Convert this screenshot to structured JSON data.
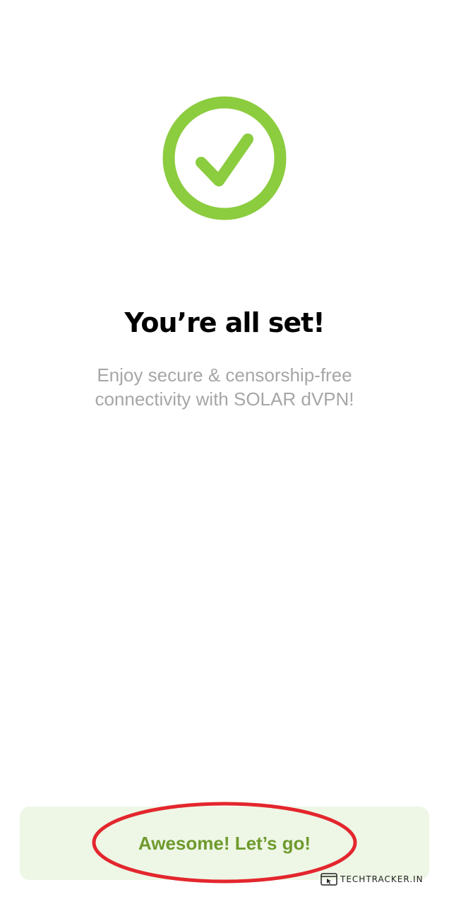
{
  "success": {
    "icon": "check-circle-icon",
    "title": "You’re all set!",
    "subtitle_line1": "Enjoy secure & censorship-free",
    "subtitle_line2": "connectivity with SOLAR dVPN!"
  },
  "cta": {
    "label": "Awesome! Let’s go!"
  },
  "annotation": {
    "shape": "ellipse-highlight",
    "color": "#e3262d"
  },
  "watermark": {
    "icon": "browser-cursor-icon",
    "text": "TECHTRACKER.IN"
  },
  "colors": {
    "accent_green": "#8ccc3f",
    "cta_background": "#eef7e6",
    "cta_text": "#6f9a2d",
    "subtitle_gray": "#a6a6a6",
    "title": "#000000"
  }
}
